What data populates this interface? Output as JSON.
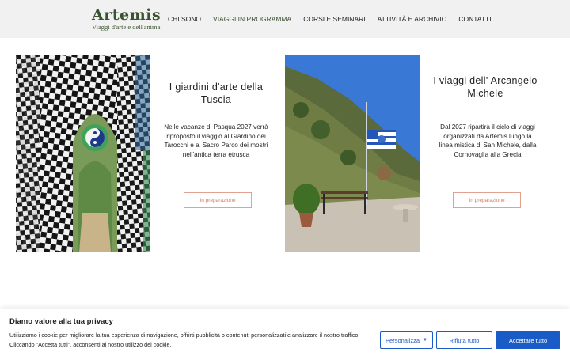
{
  "header": {
    "logo_title": "Artemis",
    "logo_subtitle": "Viaggi d'arte e dell'anima",
    "nav": [
      {
        "label": "CHI SONO",
        "active": false
      },
      {
        "label": "VIAGGI IN PROGRAMMA",
        "active": true
      },
      {
        "label": "CORSI E SEMINARI",
        "active": false
      },
      {
        "label": "ATTIVITÀ E ARCHIVIO",
        "active": false
      },
      {
        "label": "CONTATTI",
        "active": false
      }
    ]
  },
  "cards": [
    {
      "title": "I giardini d'arte della Tuscia",
      "text": "Nelle vacanze di Pasqua 2027 verrà  riproposto il viaggio al Giardino dei Tarocchi e al Sacro Parco dei mostri nell'antica terra etrusca",
      "button": "In preparazione"
    },
    {
      "title": "I viaggi dell' Arcangelo Michele",
      "text": "Dal 2027 ripartirà il ciclo di viaggi organizzati da Artemis lungo la linea mistica di San Michele, dalla Cornovaglia alla Grecia",
      "button": "In preparazione"
    }
  ],
  "cookie": {
    "title": "Diamo valore alla tua privacy",
    "text": "Utilizziamo i cookie per migliorare la tua esperienza di navigazione, offrirti pubblicità o contenuti personalizzati e analizzare il nostro traffico. Cliccando \"Accetta tutti\", acconsenti al nostro utilizzo dei cookie.",
    "customize": "Personalizza",
    "reject": "Rifiuta tutto",
    "accept": "Accettare tutto"
  },
  "colors": {
    "brand": "#3b5230",
    "button_accent": "#d47a63",
    "cookie_blue": "#1a5cc7"
  }
}
